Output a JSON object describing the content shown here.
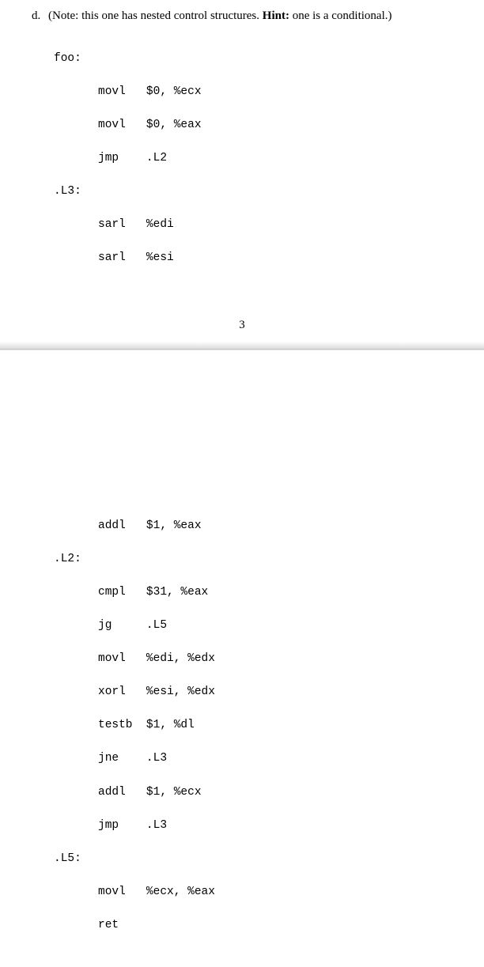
{
  "prompt": {
    "letter": "d.",
    "note_prefix": "(Note: this one has nested control structures. ",
    "hint_label": "Hint:",
    "hint_text": " one is a conditional.)"
  },
  "page_number": "3",
  "code": {
    "label_foo": "foo:",
    "line_movl_ecx": "movl   $0, %ecx",
    "line_movl_eax": "movl   $0, %eax",
    "line_jmp_l2": "jmp    .L2",
    "label_l3": ".L3:",
    "line_sarl_edi": "sarl   %edi",
    "line_sarl_esi": "sarl   %esi",
    "line_addl_eax": "addl   $1, %eax",
    "label_l2": ".L2:",
    "line_cmpl": "cmpl   $31, %eax",
    "line_jg": "jg     .L5",
    "line_movl_edx": "movl   %edi, %edx",
    "line_xorl": "xorl   %esi, %edx",
    "line_testb": "testb  $1, %dl",
    "line_jne": "jne    .L3",
    "line_addl_ecx": "addl   $1, %ecx",
    "line_jmp_l3": "jmp    .L3",
    "label_l5": ".L5:",
    "line_movl_ecx_eax": "movl   %ecx, %eax",
    "line_ret": "ret"
  }
}
